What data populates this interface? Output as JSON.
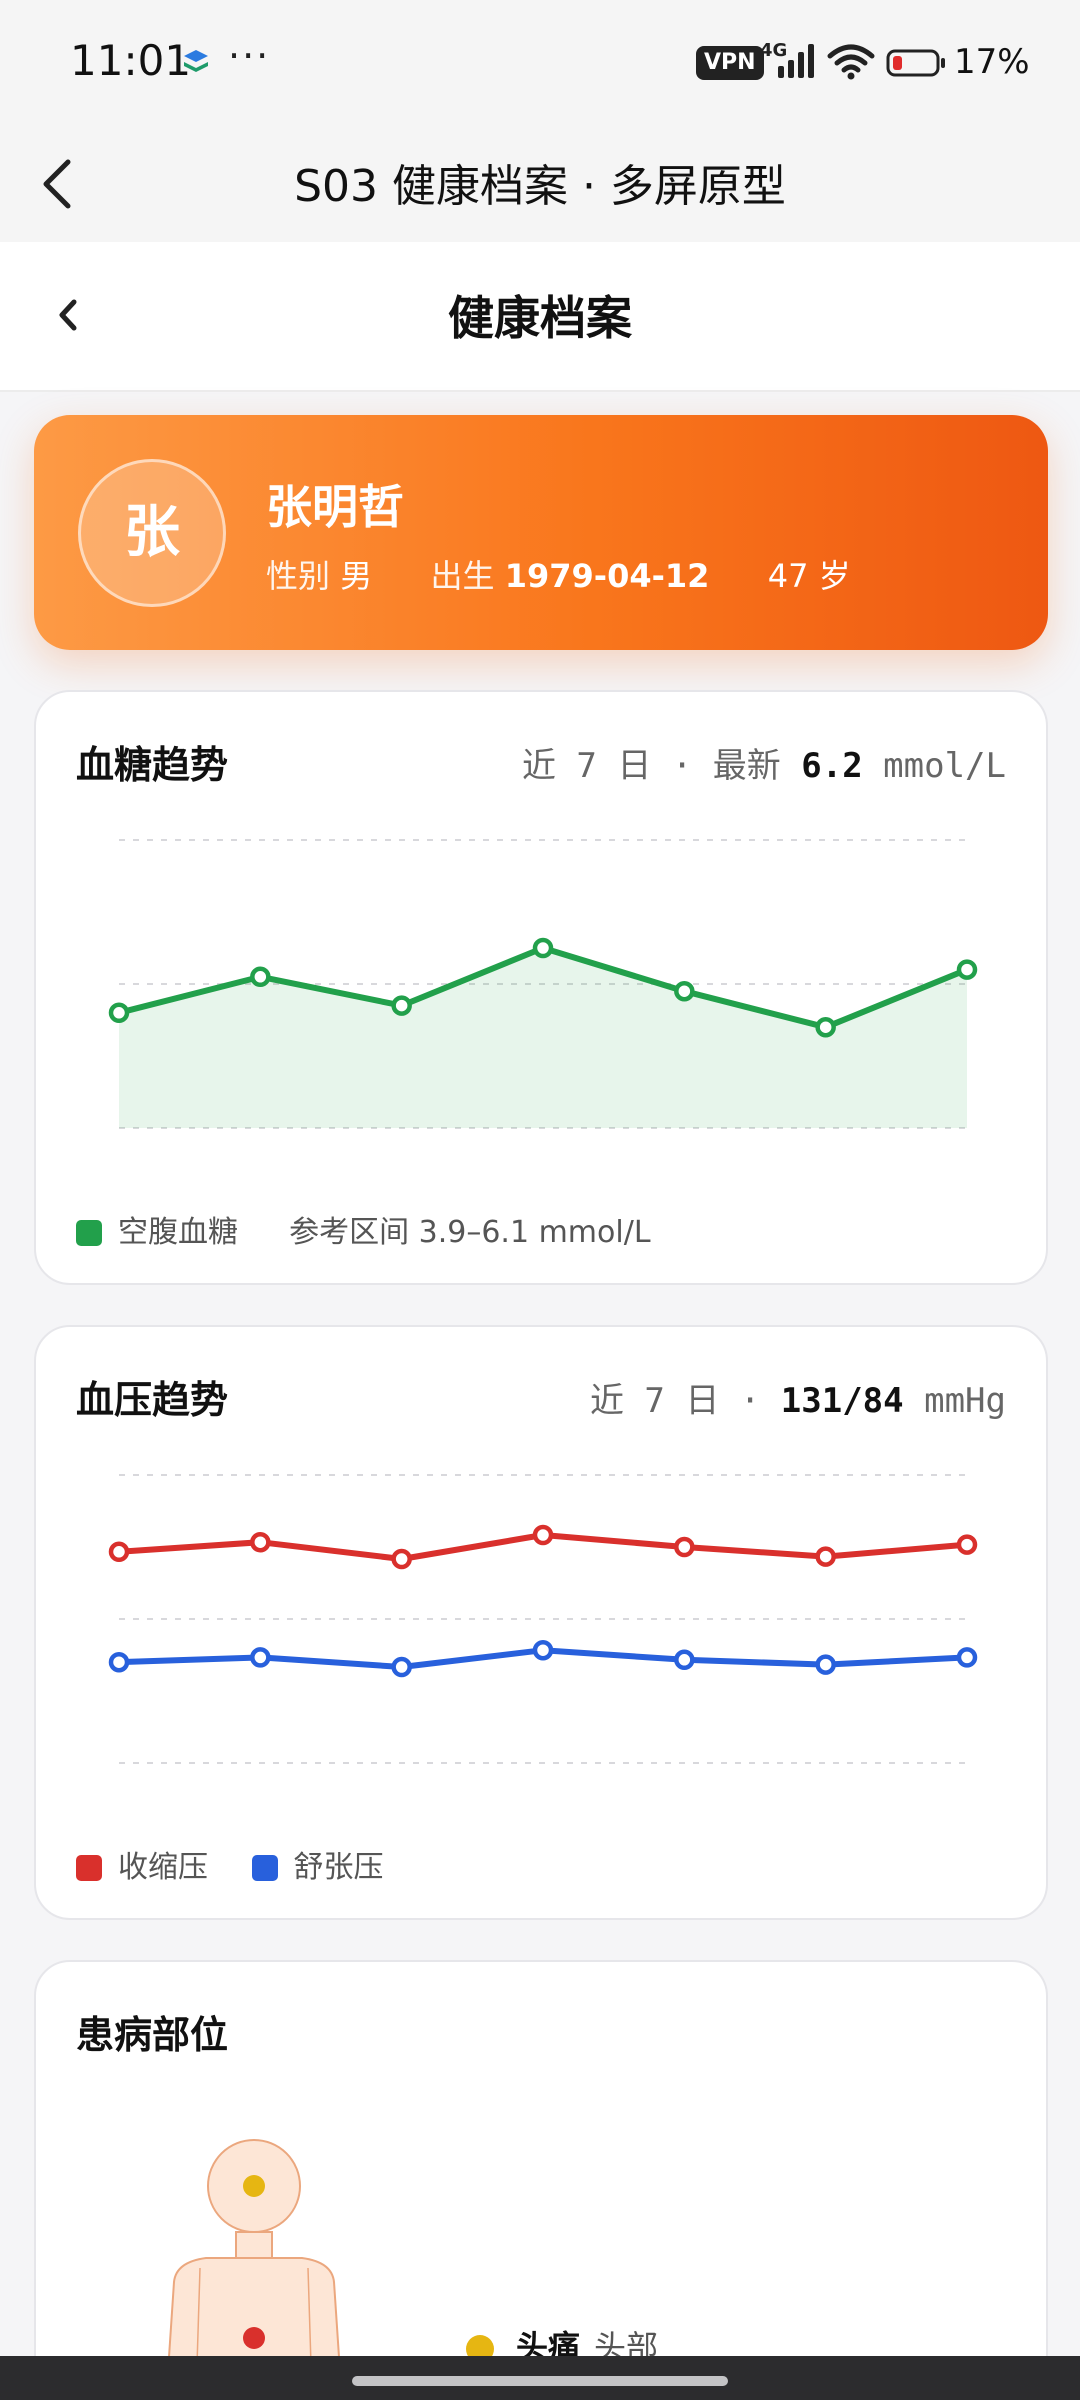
{
  "status_bar": {
    "time": "11:01",
    "dots": "···",
    "vpn": "VPN",
    "network": "4G",
    "battery": "17%"
  },
  "outer_header": {
    "title": "S03 健康档案 · 多屏原型"
  },
  "inner_header": {
    "title": "健康档案"
  },
  "profile": {
    "avatar_char": "张",
    "name": "张明哲",
    "gender_label": "性别",
    "gender": "男",
    "birth_label": "出生",
    "birth_date": "1979-04-12",
    "age": "47 岁"
  },
  "glucose": {
    "title": "血糖趋势",
    "meta_range": "近 7 日 · 最新",
    "latest_value": "6.2",
    "unit": "mmol/L",
    "legend_label": "空腹血糖",
    "reference": "参考区间 3.9–6.1 mmol/L",
    "color": "#22a04b"
  },
  "blood_pressure": {
    "title": "血压趋势",
    "meta_range": "近 7 日 ·",
    "latest_value": "131/84",
    "unit": "mmHg",
    "legend_systolic": "收缩压",
    "legend_diastolic": "舒张压",
    "systolic_color": "#d9302c",
    "diastolic_color": "#2860dc"
  },
  "body_map": {
    "title": "患病部位",
    "items": [
      {
        "name": "头痛",
        "part": "头部",
        "color": "#e6b612"
      }
    ],
    "marker_colors": [
      "#e6b612",
      "#d9302c"
    ]
  },
  "chart_data": [
    {
      "type": "area",
      "series": [
        {
          "name": "空腹血糖",
          "values": [
            5.6,
            6.1,
            5.7,
            6.5,
            5.9,
            5.4,
            6.2
          ]
        }
      ],
      "ylim": [
        4.0,
        8.0
      ],
      "grid": true
    },
    {
      "type": "line",
      "series": [
        {
          "name": "收缩压",
          "values": [
            128,
            132,
            125,
            135,
            130,
            126,
            131
          ]
        },
        {
          "name": "舒张压",
          "values": [
            82,
            84,
            80,
            87,
            83,
            81,
            84
          ]
        }
      ],
      "ylim": [
        40,
        160
      ],
      "grid": true
    }
  ]
}
